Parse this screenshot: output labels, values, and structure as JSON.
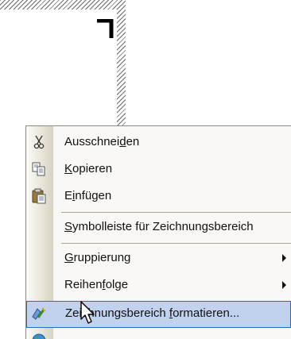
{
  "context_menu": {
    "items": [
      {
        "label_pre": "Ausschnei",
        "mnemonic": "d",
        "label_post": "en",
        "icon": "scissors-icon",
        "has_submenu": false
      },
      {
        "label_pre": "",
        "mnemonic": "K",
        "label_post": "opieren",
        "icon": "copy-icon",
        "has_submenu": false
      },
      {
        "label_pre": "E",
        "mnemonic": "i",
        "label_post": "nfügen",
        "icon": "paste-icon",
        "has_submenu": false
      },
      {
        "label_pre": "",
        "mnemonic": "S",
        "label_post": "ymbolleiste für Zeichnungsbereich",
        "icon": "",
        "has_submenu": false
      },
      {
        "label_pre": "",
        "mnemonic": "G",
        "label_post": "ruppierung",
        "icon": "",
        "has_submenu": true
      },
      {
        "label_pre": "Reihen",
        "mnemonic": "f",
        "label_post": "olge",
        "icon": "",
        "has_submenu": true
      },
      {
        "label_pre": "Zeichnungsbereich ",
        "mnemonic": "f",
        "label_post": "ormatieren...",
        "icon": "format-drawing-icon",
        "has_submenu": false,
        "highlighted": true
      },
      {
        "label_pre": "",
        "mnemonic": "",
        "label_post": "",
        "icon": "globe-icon",
        "has_submenu": false,
        "partially_visible": true
      }
    ]
  },
  "colors": {
    "highlight_fill": "#c1d2ee",
    "highlight_border": "#316ac5",
    "menu_background": "#f9f8f4"
  }
}
